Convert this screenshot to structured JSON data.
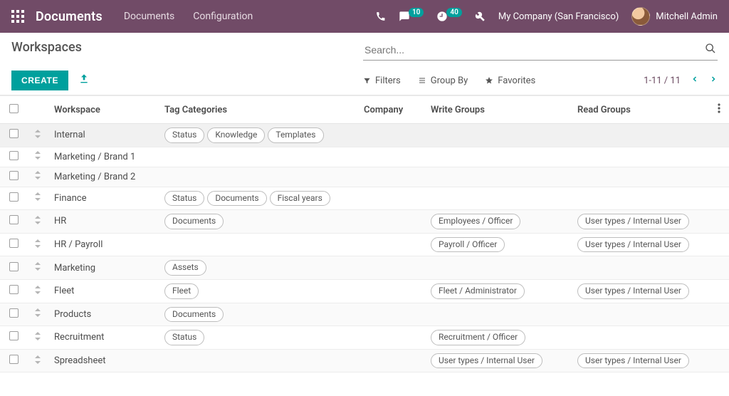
{
  "nav": {
    "brand": "Documents",
    "menu": [
      "Documents",
      "Configuration"
    ],
    "discuss_badge": "10",
    "activity_badge": "40",
    "company": "My Company (San Francisco)",
    "user": "Mitchell Admin"
  },
  "cp": {
    "title": "Workspaces",
    "create": "CREATE",
    "search_placeholder": "Search...",
    "filters": "Filters",
    "groupby": "Group By",
    "favorites": "Favorites",
    "pager": "1-11 / 11"
  },
  "columns": {
    "workspace": "Workspace",
    "tag_categories": "Tag Categories",
    "company": "Company",
    "write_groups": "Write Groups",
    "read_groups": "Read Groups"
  },
  "rows": [
    {
      "workspace": "Internal",
      "tags": [
        "Status",
        "Knowledge",
        "Templates"
      ],
      "company": "",
      "write_groups": [],
      "read_groups": []
    },
    {
      "workspace": "Marketing / Brand 1",
      "tags": [],
      "company": "",
      "write_groups": [],
      "read_groups": []
    },
    {
      "workspace": "Marketing / Brand 2",
      "tags": [],
      "company": "",
      "write_groups": [],
      "read_groups": []
    },
    {
      "workspace": "Finance",
      "tags": [
        "Status",
        "Documents",
        "Fiscal years"
      ],
      "company": "",
      "write_groups": [],
      "read_groups": []
    },
    {
      "workspace": "HR",
      "tags": [
        "Documents"
      ],
      "company": "",
      "write_groups": [
        "Employees / Officer"
      ],
      "read_groups": [
        "User types / Internal User"
      ]
    },
    {
      "workspace": "HR / Payroll",
      "tags": [],
      "company": "",
      "write_groups": [
        "Payroll / Officer"
      ],
      "read_groups": [
        "User types / Internal User"
      ]
    },
    {
      "workspace": "Marketing",
      "tags": [
        "Assets"
      ],
      "company": "",
      "write_groups": [],
      "read_groups": []
    },
    {
      "workspace": "Fleet",
      "tags": [
        "Fleet"
      ],
      "company": "",
      "write_groups": [
        "Fleet / Administrator"
      ],
      "read_groups": [
        "User types / Internal User"
      ]
    },
    {
      "workspace": "Products",
      "tags": [
        "Documents"
      ],
      "company": "",
      "write_groups": [],
      "read_groups": []
    },
    {
      "workspace": "Recruitment",
      "tags": [
        "Status"
      ],
      "company": "",
      "write_groups": [
        "Recruitment / Officer"
      ],
      "read_groups": []
    },
    {
      "workspace": "Spreadsheet",
      "tags": [],
      "company": "",
      "write_groups": [
        "User types / Internal User"
      ],
      "read_groups": [
        "User types / Internal User"
      ]
    }
  ]
}
